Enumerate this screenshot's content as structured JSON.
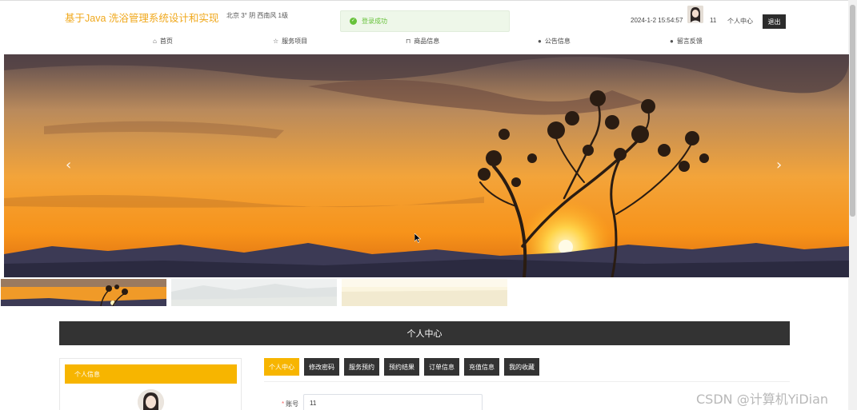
{
  "header": {
    "site_title": "基于Java 洗浴管理系统设计和实现",
    "weather": "北京  3°  阴  西南风  1级",
    "toast": "登录成功",
    "datetime": "2024-1-2 15:54:57",
    "user_id": "11",
    "center_link": "个人中心",
    "logout": "退出"
  },
  "nav": [
    {
      "label": "首页",
      "icon": "home-icon"
    },
    {
      "label": "服务项目",
      "icon": "star-icon"
    },
    {
      "label": "商品信息",
      "icon": "bag-icon"
    },
    {
      "label": "公告信息",
      "icon": "info-icon"
    },
    {
      "label": "留言反馈",
      "icon": "question-icon"
    }
  ],
  "carousel": {
    "prev": "‹",
    "next": "›"
  },
  "section": {
    "title": "个人中心"
  },
  "profile": {
    "header": "个人信息"
  },
  "tabs": [
    "个人中心",
    "修改密码",
    "服务预约",
    "预约结果",
    "订单信息",
    "充值信息",
    "我的收藏"
  ],
  "form": {
    "account_label": "账号",
    "account_value": "11"
  },
  "watermark": "CSDN @计算机YiDian",
  "colors": {
    "accent": "#f7b500",
    "title": "#f0a81c",
    "dark": "#333333"
  }
}
